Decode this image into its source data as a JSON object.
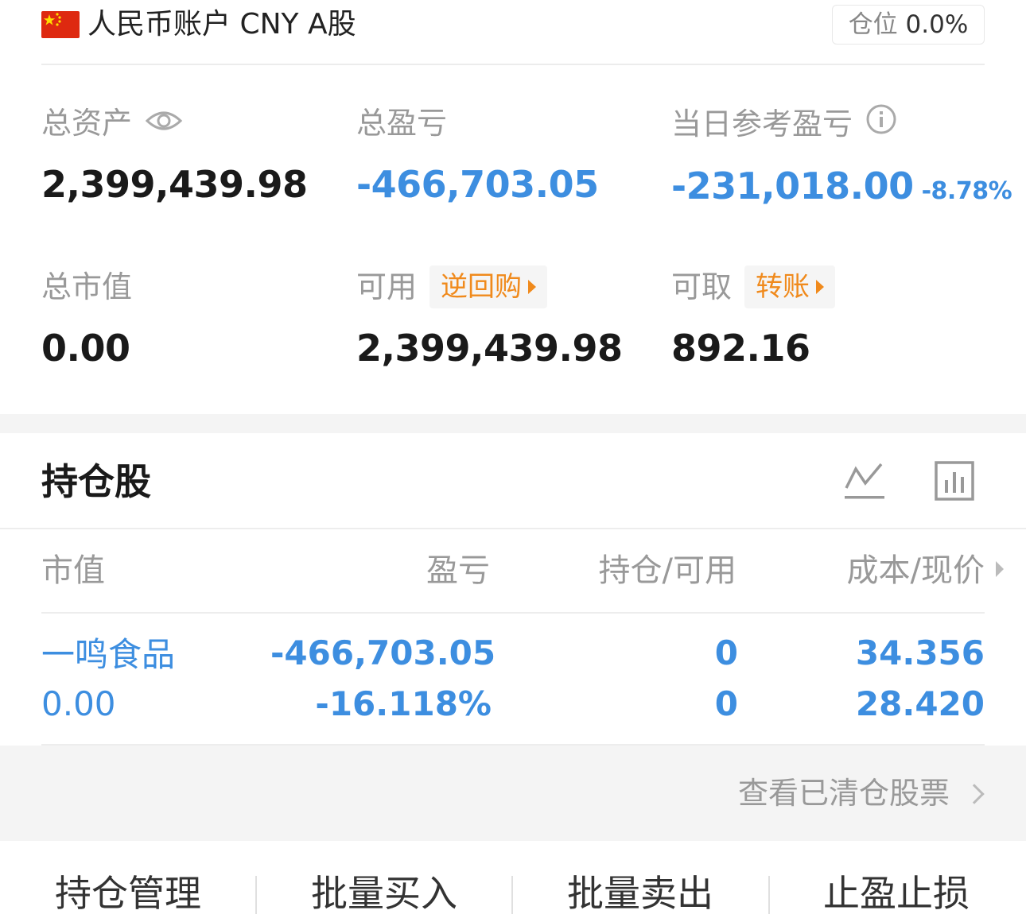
{
  "header": {
    "account_title": "人民币账户 CNY A股",
    "position_label": "仓位",
    "position_value": "0.0%"
  },
  "summary": {
    "total_assets_label": "总资产",
    "total_assets_value": "2,399,439.98",
    "total_pl_label": "总盈亏",
    "total_pl_value": "-466,703.05",
    "daily_pl_label": "当日参考盈亏",
    "daily_pl_value": "-231,018.00",
    "daily_pl_pct": "-8.78%",
    "market_value_label": "总市值",
    "market_value_value": "0.00",
    "available_label": "可用",
    "available_tag": "逆回购",
    "available_value": "2,399,439.98",
    "withdrawable_label": "可取",
    "withdrawable_tag": "转账",
    "withdrawable_value": "892.16"
  },
  "holdings": {
    "title": "持仓股",
    "columns": [
      "市值",
      "盈亏",
      "持仓/可用",
      "成本/现价"
    ],
    "rows": [
      {
        "name": "一鸣食品",
        "market_value": "0.00",
        "pl": "-466,703.05",
        "pl_pct": "-16.118%",
        "position": "0",
        "available": "0",
        "cost": "34.356",
        "price": "28.420"
      }
    ],
    "cleared_link": "查看已清仓股票"
  },
  "actions": [
    "持仓管理",
    "批量买入",
    "批量卖出",
    "止盈止损"
  ],
  "colors": {
    "loss_blue": "#3d8ee0",
    "tag_orange": "#f08a1c",
    "flag_red": "#de2910"
  }
}
